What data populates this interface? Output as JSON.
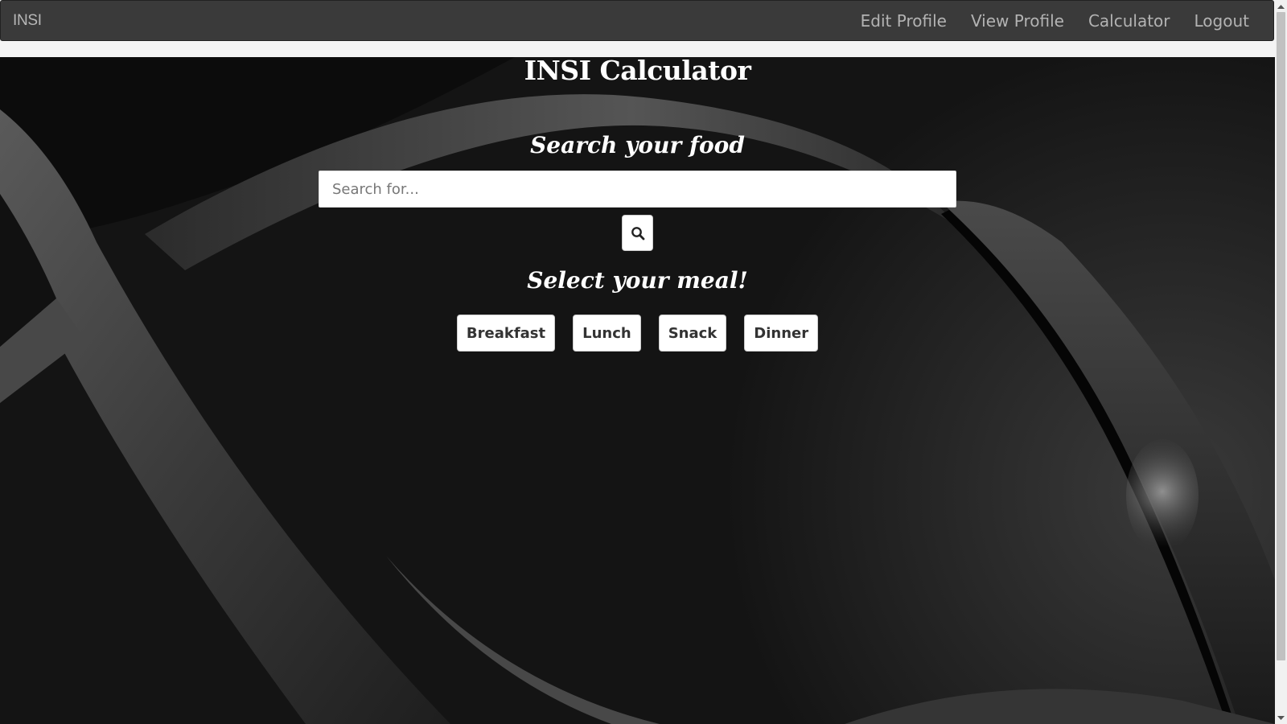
{
  "navbar": {
    "brand": "INSI",
    "links": [
      {
        "label": "Edit Profile"
      },
      {
        "label": "View Profile"
      },
      {
        "label": "Calculator"
      },
      {
        "label": "Logout"
      }
    ]
  },
  "main": {
    "title": "INSI Calculator",
    "search_heading": "Search your food",
    "search_placeholder": "Search for...",
    "search_value": "",
    "search_button_icon": "search-icon",
    "meal_heading": "Select your meal!",
    "meals": [
      {
        "label": "Breakfast"
      },
      {
        "label": "Lunch"
      },
      {
        "label": "Snack"
      },
      {
        "label": "Dinner"
      }
    ]
  },
  "colors": {
    "navbar_bg": "#3a3a3a",
    "nav_text": "#b3b3b3",
    "hero_bg": "#1a1a1a",
    "heading_text": "#ffffff",
    "button_bg": "#ffffff"
  }
}
